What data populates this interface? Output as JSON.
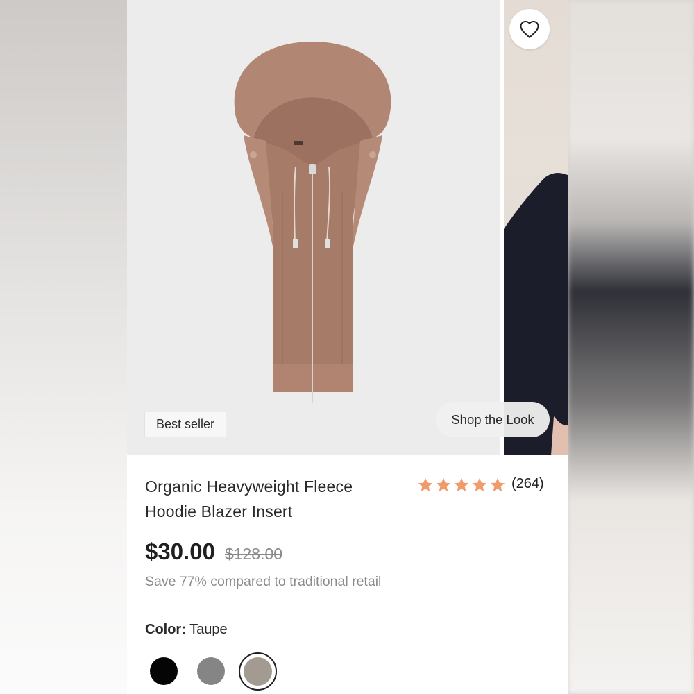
{
  "product": {
    "title_line1": "Organic Heavyweight Fleece",
    "title_line2": "Hoodie Blazer Insert",
    "badge": "Best seller",
    "shop_the_look": "Shop the Look",
    "rating": {
      "stars": 5,
      "max": 5,
      "review_count": "(264)",
      "star_color": "#f19b6b"
    },
    "price": "$30.00",
    "original_price": "$128.00",
    "savings_text": "Save 77% compared to traditional retail",
    "color": {
      "label": "Color:",
      "selected": "Taupe",
      "swatches": [
        {
          "name": "black",
          "hex": "#050505"
        },
        {
          "name": "gray",
          "hex": "#858585"
        },
        {
          "name": "taupe",
          "hex": "#a39a92",
          "selected": true
        }
      ]
    },
    "icons": {
      "wishlist": "heart-outline-icon",
      "rating": "star-icon"
    }
  }
}
